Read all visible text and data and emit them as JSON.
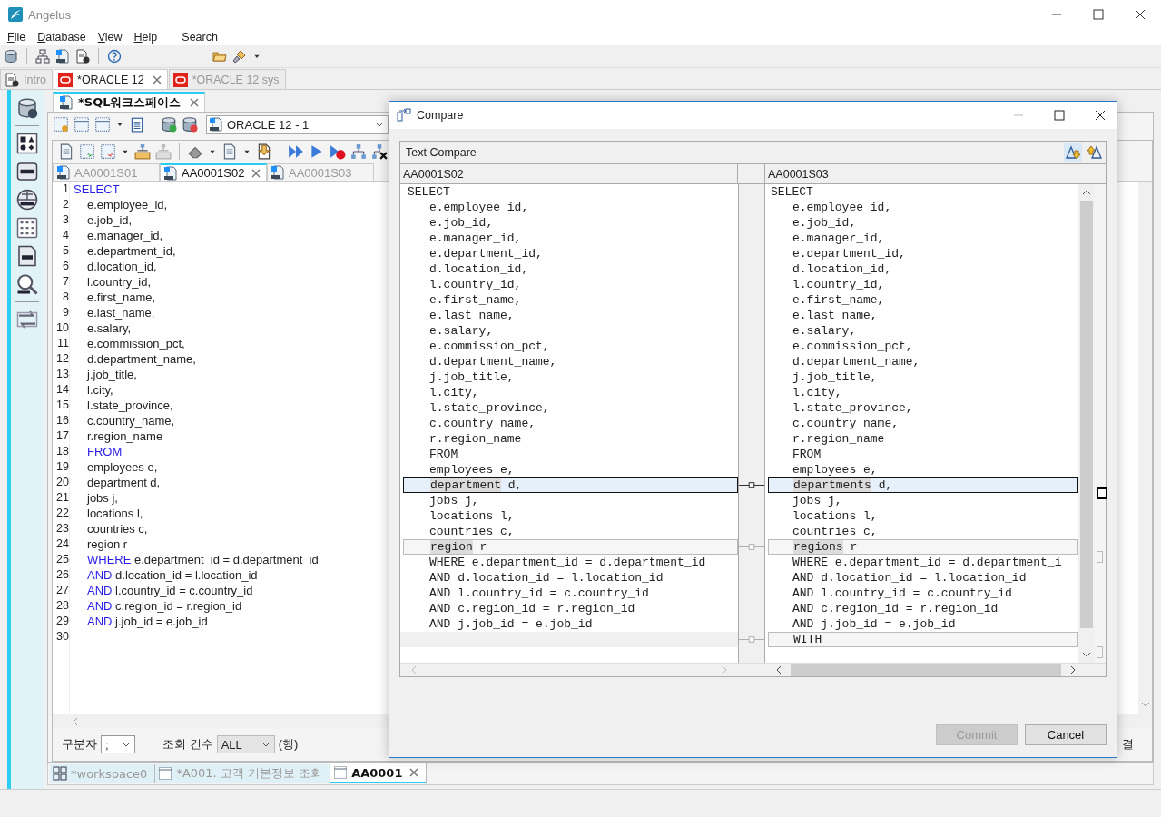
{
  "window": {
    "title": "Angelus"
  },
  "menu": [
    "File",
    "Database",
    "View",
    "Help",
    "Search"
  ],
  "perspective_tabs": [
    {
      "label": "Intro",
      "selected": false,
      "closable": false
    },
    {
      "label": "*ORACLE 12",
      "selected": true,
      "closable": true
    },
    {
      "label": "*ORACLE 12 sys",
      "selected": false,
      "closable": false
    }
  ],
  "editor_tab": {
    "label": "*SQL워크스페이스",
    "selected": true
  },
  "connection": {
    "value": "ORACLE 12 - 1"
  },
  "file_tabs": [
    {
      "label": "AA0001S01",
      "selected": false
    },
    {
      "label": "AA0001S02",
      "selected": true
    },
    {
      "label": "AA0001S03",
      "selected": false
    }
  ],
  "editor": {
    "lines": [
      {
        "n": "1",
        "indent": false,
        "keyword": "SELECT"
      },
      {
        "n": "2",
        "indent": true,
        "code": "e.employee_id,"
      },
      {
        "n": "3",
        "indent": true,
        "code": "e.job_id,"
      },
      {
        "n": "4",
        "indent": true,
        "code": "e.manager_id,"
      },
      {
        "n": "5",
        "indent": true,
        "code": "e.department_id,"
      },
      {
        "n": "6",
        "indent": true,
        "code": "d.location_id,"
      },
      {
        "n": "7",
        "indent": true,
        "code": "l.country_id,"
      },
      {
        "n": "8",
        "indent": true,
        "code": "e.first_name,"
      },
      {
        "n": "9",
        "indent": true,
        "code": "e.last_name,"
      },
      {
        "n": "10",
        "indent": true,
        "code": "e.salary,"
      },
      {
        "n": "11",
        "indent": true,
        "code": "e.commission_pct,"
      },
      {
        "n": "12",
        "indent": true,
        "code": "d.department_name,"
      },
      {
        "n": "13",
        "indent": true,
        "code": "j.job_title,"
      },
      {
        "n": "14",
        "indent": true,
        "code": "l.city,"
      },
      {
        "n": "15",
        "indent": true,
        "code": "l.state_province,"
      },
      {
        "n": "16",
        "indent": true,
        "code": "c.country_name,"
      },
      {
        "n": "17",
        "indent": true,
        "code": "r.region_name"
      },
      {
        "n": "18",
        "indent": true,
        "keyword": "FROM"
      },
      {
        "n": "19",
        "indent": true,
        "code": "employees e,"
      },
      {
        "n": "20",
        "indent": true,
        "code": "department d,"
      },
      {
        "n": "21",
        "indent": true,
        "code": "jobs j,"
      },
      {
        "n": "22",
        "indent": true,
        "code": "locations l,"
      },
      {
        "n": "23",
        "indent": true,
        "code": "countries c,"
      },
      {
        "n": "24",
        "indent": true,
        "code": "region r"
      },
      {
        "n": "25",
        "indent": true,
        "keyword": "WHERE",
        "code": "e.department_id = d.department_id"
      },
      {
        "n": "26",
        "indent": true,
        "keyword": "AND",
        "code": "d.location_id = l.location_id"
      },
      {
        "n": "27",
        "indent": true,
        "keyword": "AND",
        "code": "l.country_id = c.country_id"
      },
      {
        "n": "28",
        "indent": true,
        "keyword": "AND",
        "code": "c.region_id = r.region_id"
      },
      {
        "n": "29",
        "indent": true,
        "keyword": "AND",
        "code": "j.job_id = e.job_id"
      },
      {
        "n": "30"
      }
    ]
  },
  "options": {
    "separator_label": "구분자",
    "separator_value": ";",
    "count_label": "조회 건수",
    "count_value": "ALL",
    "count_unit": "(행)",
    "cut_label": "결"
  },
  "bottom_tabs": [
    {
      "label": "*workspace0",
      "selected": false,
      "kind": "workspace"
    },
    {
      "label": "*A001. 고객 기본정보 조회",
      "selected": false,
      "kind": "sheet"
    },
    {
      "label": "AA0001",
      "selected": true,
      "kind": "sheet"
    }
  ],
  "dialog": {
    "title": "Compare",
    "panel_title": "Text Compare",
    "left_title": "AA0001S02",
    "right_title": "AA0001S03",
    "rows": [
      {
        "indent": false,
        "changed": false,
        "selected": false,
        "left": "SELECT",
        "right": "SELECT"
      },
      {
        "indent": true,
        "changed": false,
        "selected": false,
        "left": "e.employee_id,",
        "right": "e.employee_id,"
      },
      {
        "indent": true,
        "changed": false,
        "selected": false,
        "left": "e.job_id,",
        "right": "e.job_id,"
      },
      {
        "indent": true,
        "changed": false,
        "selected": false,
        "left": "e.manager_id,",
        "right": "e.manager_id,"
      },
      {
        "indent": true,
        "changed": false,
        "selected": false,
        "left": "e.department_id,",
        "right": "e.department_id,"
      },
      {
        "indent": true,
        "changed": false,
        "selected": false,
        "left": "d.location_id,",
        "right": "d.location_id,"
      },
      {
        "indent": true,
        "changed": false,
        "selected": false,
        "left": "l.country_id,",
        "right": "l.country_id,"
      },
      {
        "indent": true,
        "changed": false,
        "selected": false,
        "left": "e.first_name,",
        "right": "e.first_name,"
      },
      {
        "indent": true,
        "changed": false,
        "selected": false,
        "left": "e.last_name,",
        "right": "e.last_name,"
      },
      {
        "indent": true,
        "changed": false,
        "selected": false,
        "left": "e.salary,",
        "right": "e.salary,"
      },
      {
        "indent": true,
        "changed": false,
        "selected": false,
        "left": "e.commission_pct,",
        "right": "e.commission_pct,"
      },
      {
        "indent": true,
        "changed": false,
        "selected": false,
        "left": "d.department_name,",
        "right": "d.department_name,"
      },
      {
        "indent": true,
        "changed": false,
        "selected": false,
        "left": "j.job_title,",
        "right": "j.job_title,"
      },
      {
        "indent": true,
        "changed": false,
        "selected": false,
        "left": "l.city,",
        "right": "l.city,"
      },
      {
        "indent": true,
        "changed": false,
        "selected": false,
        "left": "l.state_province,",
        "right": "l.state_province,"
      },
      {
        "indent": true,
        "changed": false,
        "selected": false,
        "left": "c.country_name,",
        "right": "c.country_name,"
      },
      {
        "indent": true,
        "changed": false,
        "selected": false,
        "left": "r.region_name",
        "right": "r.region_name"
      },
      {
        "indent": true,
        "changed": false,
        "selected": false,
        "left": "FROM",
        "right": "FROM"
      },
      {
        "indent": true,
        "changed": false,
        "selected": false,
        "left": "employees e,",
        "right": "employees e,"
      },
      {
        "indent": true,
        "changed": true,
        "selected": true,
        "left_changed": "department",
        "left": " d,",
        "right_changed": "departments",
        "right": " d,"
      },
      {
        "indent": true,
        "changed": false,
        "selected": false,
        "left": "jobs j,",
        "right": "jobs j,"
      },
      {
        "indent": true,
        "changed": false,
        "selected": false,
        "left": "locations l,",
        "right": "locations l,"
      },
      {
        "indent": true,
        "changed": false,
        "selected": false,
        "left": "countries c,",
        "right": "countries c,"
      },
      {
        "indent": true,
        "changed": true,
        "selected": false,
        "left_changed": "region",
        "left": " r",
        "right_changed": "regions",
        "right": " r"
      },
      {
        "indent": true,
        "changed": false,
        "selected": false,
        "left": "WHERE e.department_id = d.department_id",
        "right": "WHERE e.department_id = d.department_i"
      },
      {
        "indent": true,
        "changed": false,
        "selected": false,
        "left": "AND d.location_id = l.location_id",
        "right": "AND d.location_id = l.location_id"
      },
      {
        "indent": true,
        "changed": false,
        "selected": false,
        "left": "AND l.country_id = c.country_id",
        "right": "AND l.country_id = c.country_id"
      },
      {
        "indent": true,
        "changed": false,
        "selected": false,
        "left": "AND c.region_id = r.region_id",
        "right": "AND c.region_id = r.region_id"
      },
      {
        "indent": true,
        "changed": false,
        "selected": false,
        "left": "AND j.job_id = e.job_id",
        "right": "AND j.job_id = e.job_id"
      },
      {
        "indent": true,
        "changed": true,
        "selected": false,
        "right": "WITH"
      }
    ],
    "buttons": [
      {
        "label": "Commit",
        "disabled": true
      },
      {
        "label": "Cancel",
        "disabled": false
      }
    ]
  }
}
